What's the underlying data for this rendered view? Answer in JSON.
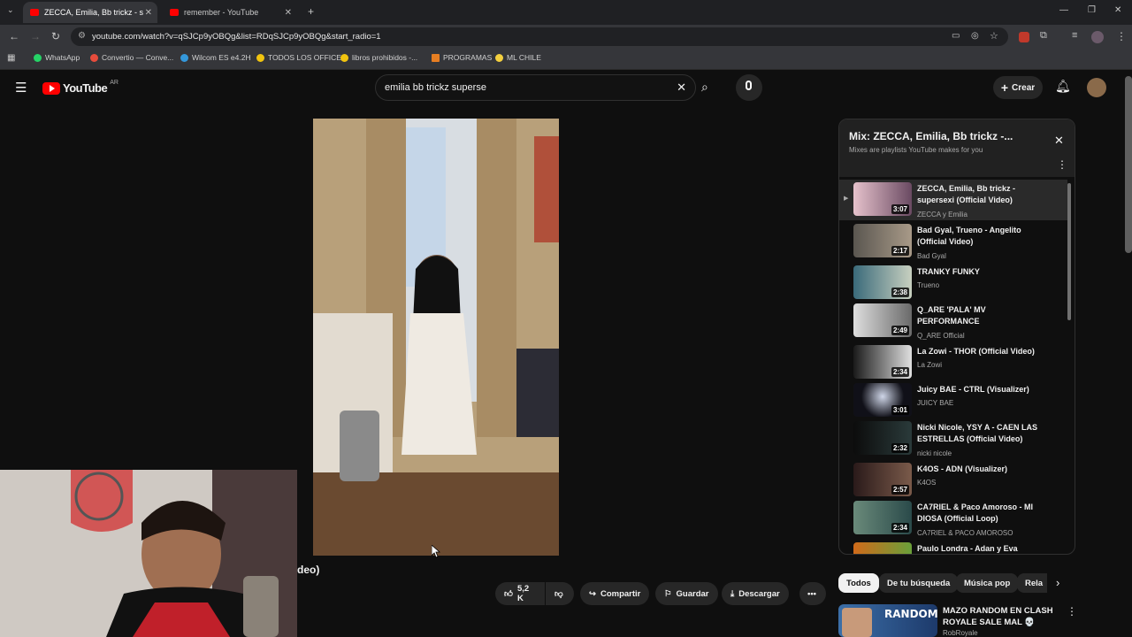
{
  "browser": {
    "tabs": [
      {
        "title": "ZECCA, Emilia, Bb trickz - s",
        "active": true
      },
      {
        "title": "remember - YouTube",
        "active": false
      }
    ],
    "url": "youtube.com/watch?v=qSJCp9yOBQg&list=RDqSJCp9yOBQg&start_radio=1",
    "bookmarks": [
      "WhatsApp",
      "Convertio — Conve...",
      "Wilcom ES e4.2H",
      "TODOS LOS OFFICE",
      "libros prohibidos -...",
      "PROGRAMAS",
      "ML CHILE"
    ]
  },
  "youtube": {
    "logo_text": "YouTube",
    "country": "AR",
    "search_value": "emilia bb trickz superse",
    "create_label": "Crear",
    "title_fragment": "deo)",
    "actions": {
      "likes": "5,2 K",
      "share": "Compartir",
      "save": "Guardar",
      "download": "Descargar"
    }
  },
  "playlist": {
    "title": "Mix: ZECCA, Emilia, Bb trickz -...",
    "subtitle": "Mixes are playlists YouTube makes for you",
    "items": [
      {
        "title": "ZECCA, Emilia, Bb trickz - supersexi (Official Video)",
        "channel": "ZECCA y Emilia",
        "duration": "3:07"
      },
      {
        "title": "Bad Gyal, Trueno - Angelito (Official Video)",
        "channel": "Bad Gyal",
        "duration": "2:17"
      },
      {
        "title": "TRANKY FUNKY",
        "channel": "Trueno",
        "duration": "2:38"
      },
      {
        "title": "Q_ARE 'PALA' MV PERFORMANCE",
        "channel": "Q_ARE Official",
        "duration": "2:49"
      },
      {
        "title": "La Zowi - THOR (Official Video)",
        "channel": "La Zowi",
        "duration": "2:34"
      },
      {
        "title": "Juicy BAE - CTRL (Visualizer)",
        "channel": "JUICY BAE",
        "duration": "3:01"
      },
      {
        "title": "Nicki Nicole, YSY A - CAEN LAS ESTRELLAS (Official Video)",
        "channel": "nicki nicole",
        "duration": "2:32"
      },
      {
        "title": "K4OS - ADN (Visualizer)",
        "channel": "K4OS",
        "duration": "2:57"
      },
      {
        "title": "CA7RIEL & Paco Amoroso - MI DIOSA (Official Loop)",
        "channel": "CA7RIEL & PACO AMOROSO",
        "duration": "2:34"
      },
      {
        "title": "Paulo Londra - Adan y Eva",
        "channel": "",
        "duration": ""
      }
    ]
  },
  "chips": [
    "Todos",
    "De tu búsqueda",
    "Música pop",
    "Rela"
  ],
  "recommendation": {
    "title": "MAZO RANDOM EN CLASH ROYALE SALE MAL 💀",
    "channel": "RobRoyale",
    "thumb_text": "RANDOM"
  }
}
